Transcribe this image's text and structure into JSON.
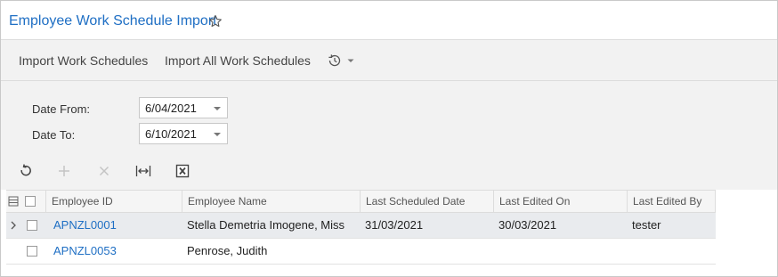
{
  "header": {
    "title": "Employee Work Schedule Import",
    "favorite_icon": "star-outline-icon"
  },
  "toolbar": {
    "import_label": "Import Work Schedules",
    "import_all_label": "Import All Work Schedules",
    "history_icon": "history-clock-icon"
  },
  "filters": {
    "date_from_label": "Date From:",
    "date_from_value": "6/04/2021",
    "date_to_label": "Date To:",
    "date_to_value": "6/10/2021"
  },
  "grid_toolbar": {
    "icons": [
      "refresh-icon",
      "add-icon",
      "delete-icon",
      "fit-columns-icon",
      "export-excel-icon"
    ]
  },
  "grid": {
    "columns": [
      "Employee ID",
      "Employee Name",
      "Last Scheduled Date",
      "Last Edited On",
      "Last Edited By"
    ],
    "rows": [
      {
        "employee_id": "APNZL0001",
        "employee_name": "Stella Demetria Imogene, Miss",
        "last_scheduled_date": "31/03/2021",
        "last_edited_on": "30/03/2021",
        "last_edited_by": "tester"
      },
      {
        "employee_id": "APNZL0053",
        "employee_name": "Penrose, Judith",
        "last_scheduled_date": "",
        "last_edited_on": "",
        "last_edited_by": ""
      }
    ]
  },
  "colors": {
    "link": "#1f6fc4",
    "toolbar_bg": "#f2f2f2",
    "selected_row": "#e9ebee"
  }
}
